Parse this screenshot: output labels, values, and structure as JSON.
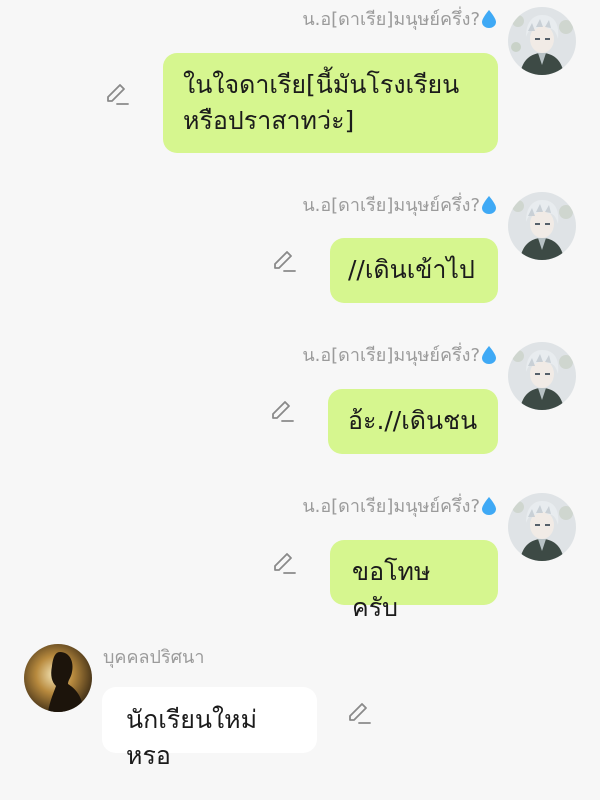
{
  "colors": {
    "my_bubble": "#d6f68f",
    "their_bubble": "#ffffff",
    "background": "#f7f7f7",
    "name_text": "#9b9b9b",
    "drop_icon": "#3fa9f5"
  },
  "messages": [
    {
      "sender": "น.อ[ดาเรีย]มนุษย์ครึ่ง?",
      "sender_icon": "water-drop-icon",
      "text": "ในใจดาเรีย[นี้มันโรงเรียน\nหรือปราสาทว่ะ]",
      "edit_icon": "pencil-icon"
    },
    {
      "sender": "น.อ[ดาเรีย]มนุษย์ครึ่ง?",
      "sender_icon": "water-drop-icon",
      "text": "//เดินเข้าไป",
      "edit_icon": "pencil-icon"
    },
    {
      "sender": "น.อ[ดาเรีย]มนุษย์ครึ่ง?",
      "sender_icon": "water-drop-icon",
      "text": "อ้ะ.//เดินชน",
      "edit_icon": "pencil-icon"
    },
    {
      "sender": "น.อ[ดาเรีย]มนุษย์ครึ่ง?",
      "sender_icon": "water-drop-icon",
      "text": "ขอโทษครับ",
      "edit_icon": "pencil-icon"
    },
    {
      "sender": "บุคคลปริศนา",
      "text": "นักเรียนใหม่หรอ",
      "edit_icon": "pencil-icon"
    }
  ]
}
